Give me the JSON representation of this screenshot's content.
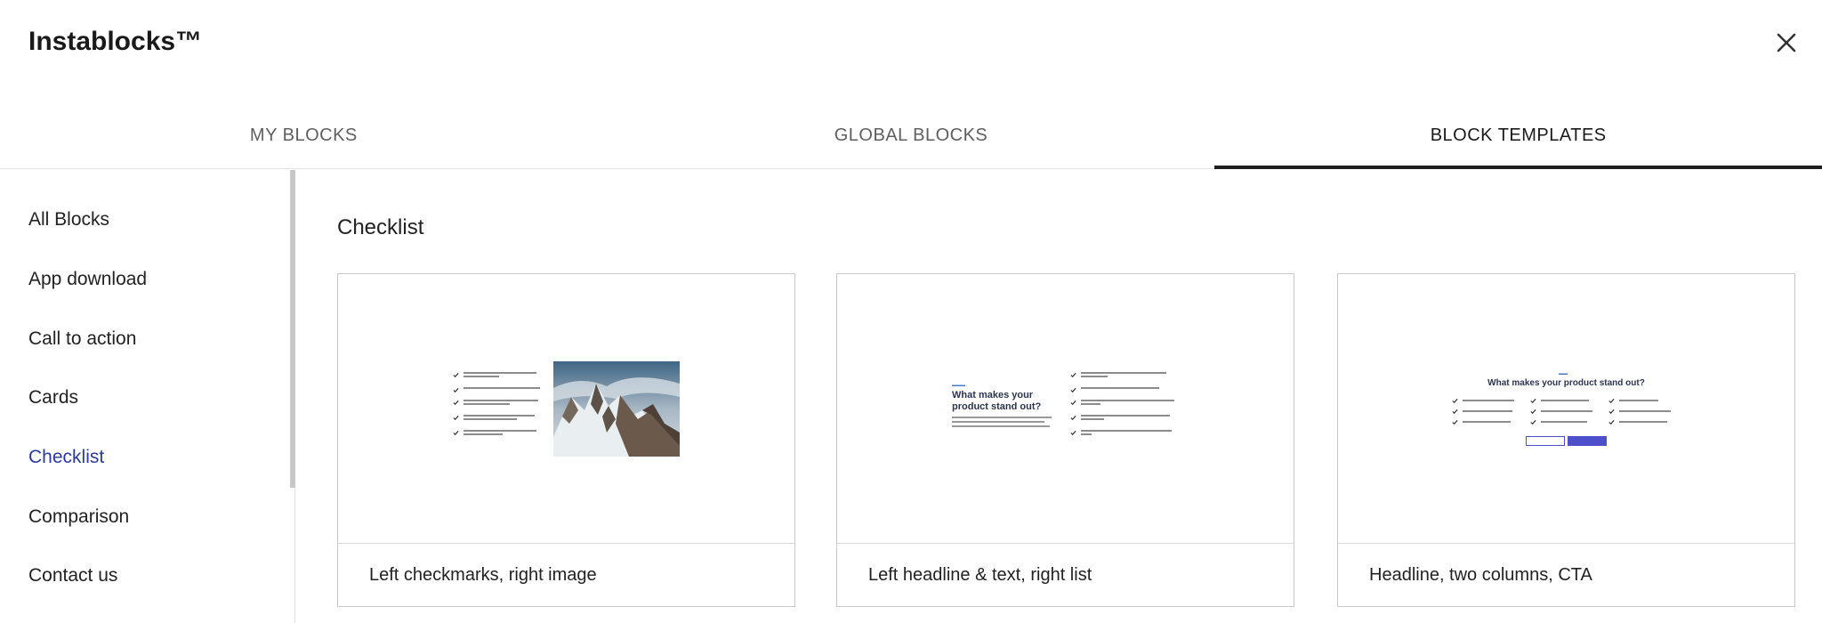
{
  "app": {
    "title": "Instablocks™"
  },
  "tabs": [
    {
      "label": "MY BLOCKS",
      "active": false
    },
    {
      "label": "GLOBAL BLOCKS",
      "active": false
    },
    {
      "label": "BLOCK TEMPLATES",
      "active": true
    }
  ],
  "sidebar": {
    "items": [
      {
        "label": "All Blocks",
        "active": false
      },
      {
        "label": "App download",
        "active": false
      },
      {
        "label": "Call to action",
        "active": false
      },
      {
        "label": "Cards",
        "active": false
      },
      {
        "label": "Checklist",
        "active": true
      },
      {
        "label": "Comparison",
        "active": false
      },
      {
        "label": "Contact us",
        "active": false
      }
    ]
  },
  "main": {
    "section_title": "Checklist",
    "cards": [
      {
        "label": "Left checkmarks, right image"
      },
      {
        "label": "Left headline & text, right list",
        "preview_headline": "What makes your product stand out?"
      },
      {
        "label": "Headline, two columns, CTA",
        "preview_headline": "What makes your product stand out?"
      }
    ]
  },
  "colors": {
    "accent": "#2b3a9e",
    "active_tab_underline": "#1f1f1f",
    "cta_button": "#4c4fc9"
  },
  "icons": {
    "close": "close-icon",
    "check": "check-icon"
  }
}
